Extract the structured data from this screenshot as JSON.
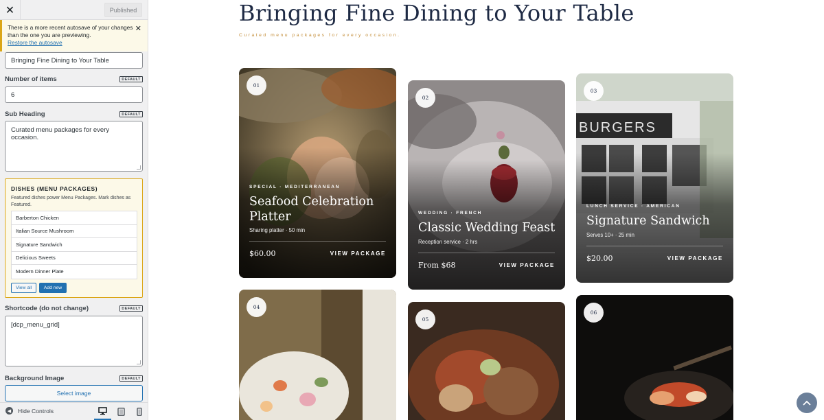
{
  "topbar": {
    "close_symbol": "✕",
    "publish_label": "Published"
  },
  "notice": {
    "text": "There is a more recent autosave of your changes than the one you are previewing.",
    "link": "Restore the autosave",
    "close_symbol": "✕"
  },
  "fields": {
    "title_value": "Bringing Fine Dining to Your Table",
    "number_label": "Number of items",
    "number_value": "6",
    "subheading_label": "Sub Heading",
    "subheading_value": "Curated menu packages for every occasion.",
    "shortcode_label": "Shortcode (do not change)",
    "shortcode_value": "[dcp_menu_grid]",
    "background_label": "Background Image",
    "select_image_label": "Select image",
    "default_badge": "DEFAULT"
  },
  "dishes": {
    "title": "DISHES (MENU PACKAGES)",
    "description": "Featured dishes power Menu Packages. Mark dishes as Featured.",
    "items": [
      "Barberton Chicken",
      "Italian Source Mushroom",
      "Signature Sandwich",
      "Delicious Sweets",
      "Modern Dinner Plate"
    ],
    "view_all": "View all",
    "add_new": "Add new"
  },
  "footer": {
    "hide_controls": "Hide Controls"
  },
  "preview": {
    "title": "Bringing Fine Dining to Your Table",
    "subtitle": "Curated menu packages for every occasion.",
    "cards": [
      {
        "num": "01",
        "tag": "SPECIAL · MEDITERRANEAN",
        "title": "Seafood Celebration Platter",
        "meta": "Sharing platter · 50 min",
        "price": "$60.00",
        "link": "VIEW PACKAGE"
      },
      {
        "num": "02",
        "tag": "WEDDING · FRENCH",
        "title": "Classic Wedding Feast",
        "meta": "Reception service · 2 hrs",
        "price": "From $68",
        "link": "VIEW PACKAGE"
      },
      {
        "num": "03",
        "tag": "LUNCH SERVICE · AMERICAN",
        "title": "Signature Sandwich",
        "meta": "Serves 10+ · 25 min",
        "price": "$20.00",
        "link": "VIEW PACKAGE",
        "sign": "BURGERS"
      },
      {
        "num": "04"
      },
      {
        "num": "05"
      },
      {
        "num": "06"
      }
    ]
  },
  "colors": {
    "accent": "#2271b1",
    "title_navy": "#1e2a44",
    "subtitle_gold": "#c28b35",
    "notice_border": "#dba617"
  }
}
